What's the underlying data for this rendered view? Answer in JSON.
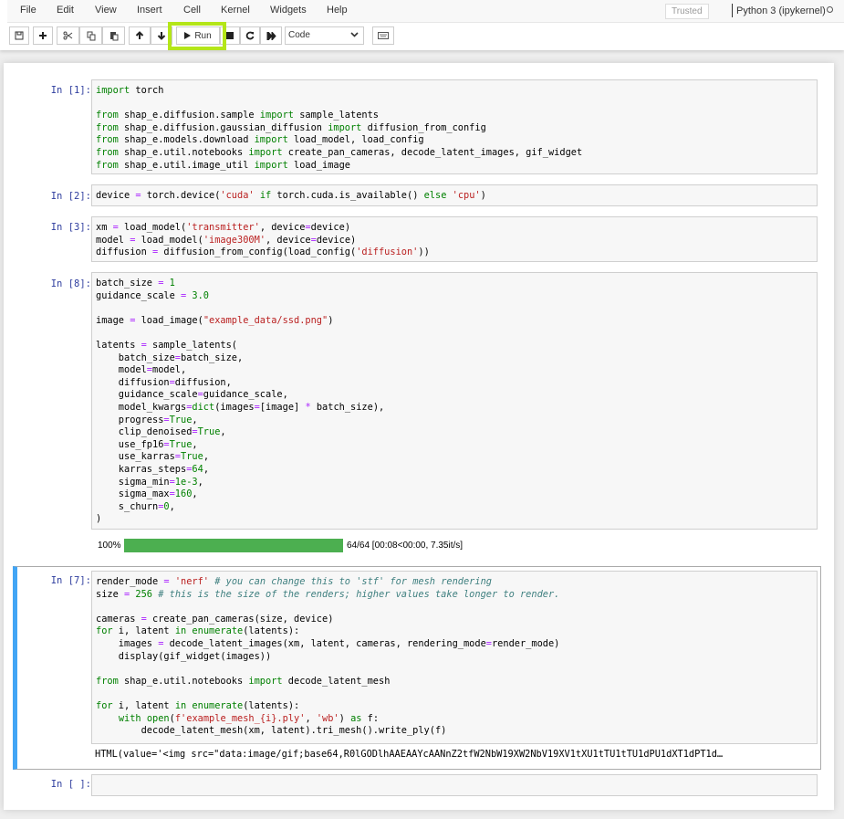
{
  "menubar": {
    "items": [
      "File",
      "Edit",
      "View",
      "Insert",
      "Cell",
      "Kernel",
      "Widgets",
      "Help"
    ],
    "trusted_label": "Trusted",
    "kernel_name": "Python 3 (ipykernel)",
    "kernel_status": "idle"
  },
  "toolbar": {
    "save_icon": "save-icon",
    "insert_icon": "plus-icon",
    "cut_icon": "scissors-icon",
    "copy_icon": "copy-icon",
    "paste_icon": "paste-icon",
    "move_up_icon": "arrow-up-icon",
    "move_down_icon": "arrow-down-icon",
    "run_label": "Run",
    "interrupt_icon": "stop-icon",
    "restart_icon": "restart-icon",
    "restart_run_all_icon": "fast-forward-icon",
    "cell_type": "Code",
    "command_palette_icon": "keyboard-icon",
    "highlight_color": "#b4e619"
  },
  "cells": [
    {
      "prompt": "In [1]:",
      "lines": [
        [
          [
            "kw",
            "import"
          ],
          [
            "t",
            " torch"
          ]
        ],
        [],
        [
          [
            "kw",
            "from"
          ],
          [
            "t",
            " shap_e.diffusion.sample "
          ],
          [
            "kw",
            "import"
          ],
          [
            "t",
            " sample_latents"
          ]
        ],
        [
          [
            "kw",
            "from"
          ],
          [
            "t",
            " shap_e.diffusion.gaussian_diffusion "
          ],
          [
            "kw",
            "import"
          ],
          [
            "t",
            " diffusion_from_config"
          ]
        ],
        [
          [
            "kw",
            "from"
          ],
          [
            "t",
            " shap_e.models.download "
          ],
          [
            "kw",
            "import"
          ],
          [
            "t",
            " load_model, load_config"
          ]
        ],
        [
          [
            "kw",
            "from"
          ],
          [
            "t",
            " shap_e.util.notebooks "
          ],
          [
            "kw",
            "import"
          ],
          [
            "t",
            " create_pan_cameras, decode_latent_images, gif_widget"
          ]
        ],
        [
          [
            "kw",
            "from"
          ],
          [
            "t",
            " shap_e.util.image_util "
          ],
          [
            "kw",
            "import"
          ],
          [
            "t",
            " load_image"
          ]
        ]
      ]
    },
    {
      "prompt": "In [2]:",
      "lines": [
        [
          [
            "t",
            "device "
          ],
          [
            "op",
            "="
          ],
          [
            "t",
            " torch.device("
          ],
          [
            "str",
            "'cuda'"
          ],
          [
            "t",
            " "
          ],
          [
            "kw",
            "if"
          ],
          [
            "t",
            " torch.cuda.is_available() "
          ],
          [
            "kw",
            "else"
          ],
          [
            "t",
            " "
          ],
          [
            "str",
            "'cpu'"
          ],
          [
            "t",
            ")"
          ]
        ]
      ]
    },
    {
      "prompt": "In [3]:",
      "lines": [
        [
          [
            "t",
            "xm "
          ],
          [
            "op",
            "="
          ],
          [
            "t",
            " load_model("
          ],
          [
            "str",
            "'transmitter'"
          ],
          [
            "t",
            ", device"
          ],
          [
            "op",
            "="
          ],
          [
            "t",
            "device)"
          ]
        ],
        [
          [
            "t",
            "model "
          ],
          [
            "op",
            "="
          ],
          [
            "t",
            " load_model("
          ],
          [
            "str",
            "'image300M'"
          ],
          [
            "t",
            ", device"
          ],
          [
            "op",
            "="
          ],
          [
            "t",
            "device)"
          ]
        ],
        [
          [
            "t",
            "diffusion "
          ],
          [
            "op",
            "="
          ],
          [
            "t",
            " diffusion_from_config(load_config("
          ],
          [
            "str",
            "'diffusion'"
          ],
          [
            "t",
            "))"
          ]
        ]
      ]
    },
    {
      "prompt": "In [8]:",
      "lines": [
        [
          [
            "t",
            "batch_size "
          ],
          [
            "op",
            "="
          ],
          [
            "t",
            " "
          ],
          [
            "num",
            "1"
          ]
        ],
        [
          [
            "t",
            "guidance_scale "
          ],
          [
            "op",
            "="
          ],
          [
            "t",
            " "
          ],
          [
            "num",
            "3.0"
          ]
        ],
        [],
        [
          [
            "t",
            "image "
          ],
          [
            "op",
            "="
          ],
          [
            "t",
            " load_image("
          ],
          [
            "str",
            "\"example_data/ssd.png\""
          ],
          [
            "t",
            ")"
          ]
        ],
        [],
        [
          [
            "t",
            "latents "
          ],
          [
            "op",
            "="
          ],
          [
            "t",
            " sample_latents("
          ]
        ],
        [
          [
            "t",
            "    batch_size"
          ],
          [
            "op",
            "="
          ],
          [
            "t",
            "batch_size,"
          ]
        ],
        [
          [
            "t",
            "    model"
          ],
          [
            "op",
            "="
          ],
          [
            "t",
            "model,"
          ]
        ],
        [
          [
            "t",
            "    diffusion"
          ],
          [
            "op",
            "="
          ],
          [
            "t",
            "diffusion,"
          ]
        ],
        [
          [
            "t",
            "    guidance_scale"
          ],
          [
            "op",
            "="
          ],
          [
            "t",
            "guidance_scale,"
          ]
        ],
        [
          [
            "t",
            "    model_kwargs"
          ],
          [
            "op",
            "="
          ],
          [
            "bi",
            "dict"
          ],
          [
            "t",
            "(images"
          ],
          [
            "op",
            "="
          ],
          [
            "t",
            "[image] "
          ],
          [
            "op",
            "*"
          ],
          [
            "t",
            " batch_size),"
          ]
        ],
        [
          [
            "t",
            "    progress"
          ],
          [
            "op",
            "="
          ],
          [
            "kw",
            "True"
          ],
          [
            "t",
            ","
          ]
        ],
        [
          [
            "t",
            "    clip_denoised"
          ],
          [
            "op",
            "="
          ],
          [
            "kw",
            "True"
          ],
          [
            "t",
            ","
          ]
        ],
        [
          [
            "t",
            "    use_fp16"
          ],
          [
            "op",
            "="
          ],
          [
            "kw",
            "True"
          ],
          [
            "t",
            ","
          ]
        ],
        [
          [
            "t",
            "    use_karras"
          ],
          [
            "op",
            "="
          ],
          [
            "kw",
            "True"
          ],
          [
            "t",
            ","
          ]
        ],
        [
          [
            "t",
            "    karras_steps"
          ],
          [
            "op",
            "="
          ],
          [
            "num",
            "64"
          ],
          [
            "t",
            ","
          ]
        ],
        [
          [
            "t",
            "    sigma_min"
          ],
          [
            "op",
            "="
          ],
          [
            "num",
            "1e-3"
          ],
          [
            "t",
            ","
          ]
        ],
        [
          [
            "t",
            "    sigma_max"
          ],
          [
            "op",
            "="
          ],
          [
            "num",
            "160"
          ],
          [
            "t",
            ","
          ]
        ],
        [
          [
            "t",
            "    s_churn"
          ],
          [
            "op",
            "="
          ],
          [
            "num",
            "0"
          ],
          [
            "t",
            ","
          ]
        ],
        [
          [
            "t",
            ")"
          ]
        ]
      ],
      "output": {
        "type": "progress",
        "percent_label": "100%",
        "progress": 1.0,
        "status": "64/64 [00:08<00:00, 7.35it/s]",
        "bar_color": "#4caf50"
      }
    },
    {
      "prompt": "In [7]:",
      "selected": true,
      "lines": [
        [
          [
            "t",
            "render_mode "
          ],
          [
            "op",
            "="
          ],
          [
            "t",
            " "
          ],
          [
            "str",
            "'nerf'"
          ],
          [
            "t",
            " "
          ],
          [
            "cmt",
            "# you can change this to 'stf' for mesh rendering"
          ]
        ],
        [
          [
            "t",
            "size "
          ],
          [
            "op",
            "="
          ],
          [
            "t",
            " "
          ],
          [
            "num",
            "256"
          ],
          [
            "t",
            " "
          ],
          [
            "cmt",
            "# this is the size of the renders; higher values take longer to render."
          ]
        ],
        [],
        [
          [
            "t",
            "cameras "
          ],
          [
            "op",
            "="
          ],
          [
            "t",
            " create_pan_cameras(size, device)"
          ]
        ],
        [
          [
            "kw",
            "for"
          ],
          [
            "t",
            " i, latent "
          ],
          [
            "kw",
            "in"
          ],
          [
            "t",
            " "
          ],
          [
            "bi",
            "enumerate"
          ],
          [
            "t",
            "(latents):"
          ]
        ],
        [
          [
            "t",
            "    images "
          ],
          [
            "op",
            "="
          ],
          [
            "t",
            " decode_latent_images(xm, latent, cameras, rendering_mode"
          ],
          [
            "op",
            "="
          ],
          [
            "t",
            "render_mode)"
          ]
        ],
        [
          [
            "t",
            "    display(gif_widget(images))"
          ]
        ],
        [],
        [
          [
            "kw",
            "from"
          ],
          [
            "t",
            " shap_e.util.notebooks "
          ],
          [
            "kw",
            "import"
          ],
          [
            "t",
            " decode_latent_mesh"
          ]
        ],
        [],
        [
          [
            "kw",
            "for"
          ],
          [
            "t",
            " i, latent "
          ],
          [
            "kw",
            "in"
          ],
          [
            "t",
            " "
          ],
          [
            "bi",
            "enumerate"
          ],
          [
            "t",
            "(latents):"
          ]
        ],
        [
          [
            "t",
            "    "
          ],
          [
            "kw",
            "with"
          ],
          [
            "t",
            " "
          ],
          [
            "bi",
            "open"
          ],
          [
            "t",
            "("
          ],
          [
            "str",
            "f'example_mesh_{i}.ply'"
          ],
          [
            "t",
            ", "
          ],
          [
            "str",
            "'wb'"
          ],
          [
            "t",
            ") "
          ],
          [
            "kw",
            "as"
          ],
          [
            "t",
            " f:"
          ]
        ],
        [
          [
            "t",
            "        decode_latent_mesh(xm, latent).tri_mesh().write_ply(f)"
          ]
        ]
      ],
      "output": {
        "type": "text",
        "text": "HTML(value='<img src=\"data:image/gif;base64,R0lGODlhAAEAAYcAANnZ2tfW2NbW19XW2NbV19XV1tXU1tTU1tTU1dPU1dXT1dPT1d…"
      }
    },
    {
      "prompt": "In [ ]:",
      "lines": []
    }
  ]
}
